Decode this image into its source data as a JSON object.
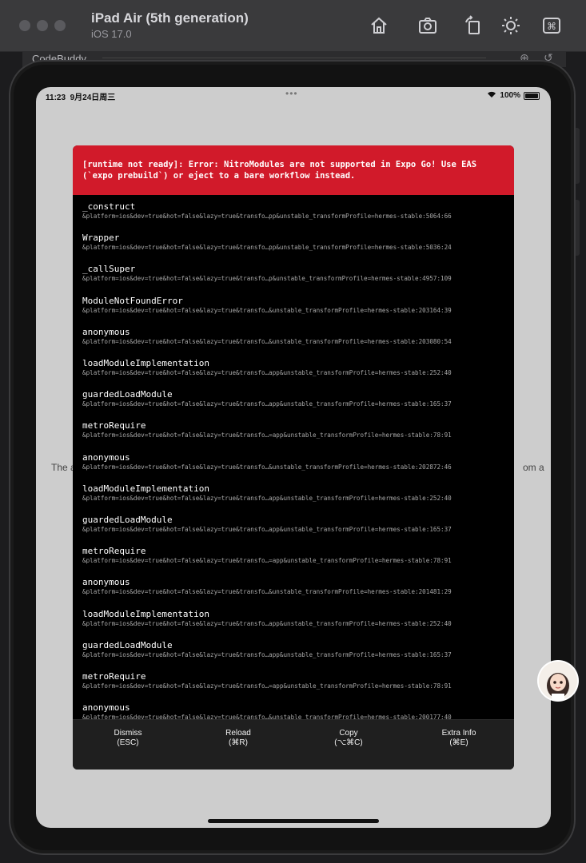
{
  "simulator": {
    "device_name": "iPad Air (5th generation)",
    "os_version": "iOS 17.0",
    "toolbar_icons": [
      "home-icon",
      "screenshot-icon",
      "rotate-icon",
      "appearance-icon",
      "command-icon"
    ]
  },
  "background_window": {
    "title": "CodeBuddy",
    "icons": [
      "add-icon",
      "history-icon"
    ]
  },
  "status_bar": {
    "time": "11:23",
    "date": "9月24日周三",
    "battery": "100%"
  },
  "background_app_text": {
    "left": "The a",
    "right": "om a"
  },
  "error": {
    "message": "[runtime not ready]: Error: NitroModules are not supported in Expo Go! Use EAS (`expo prebuild`) or eject to a bare workflow instead.",
    "stack": [
      {
        "name": "_construct",
        "location": "&platform=ios&dev=true&hot=false&lazy=true&transfo…pp&unstable_transformProfile=hermes-stable:5064:66"
      },
      {
        "name": "Wrapper",
        "location": "&platform=ios&dev=true&hot=false&lazy=true&transfo…pp&unstable_transformProfile=hermes-stable:5036:24"
      },
      {
        "name": "_callSuper",
        "location": "&platform=ios&dev=true&hot=false&lazy=true&transfo…p&unstable_transformProfile=hermes-stable:4957:109"
      },
      {
        "name": "ModuleNotFoundError",
        "location": "&platform=ios&dev=true&hot=false&lazy=true&transfo…&unstable_transformProfile=hermes-stable:203164:39"
      },
      {
        "name": "anonymous",
        "location": "&platform=ios&dev=true&hot=false&lazy=true&transfo…&unstable_transformProfile=hermes-stable:203080:54"
      },
      {
        "name": "loadModuleImplementation",
        "location": "&platform=ios&dev=true&hot=false&lazy=true&transfo…app&unstable_transformProfile=hermes-stable:252:40"
      },
      {
        "name": "guardedLoadModule",
        "location": "&platform=ios&dev=true&hot=false&lazy=true&transfo…app&unstable_transformProfile=hermes-stable:165:37"
      },
      {
        "name": "metroRequire",
        "location": "&platform=ios&dev=true&hot=false&lazy=true&transfo…=app&unstable_transformProfile=hermes-stable:78:91"
      },
      {
        "name": "anonymous",
        "location": "&platform=ios&dev=true&hot=false&lazy=true&transfo…&unstable_transformProfile=hermes-stable:202872:46"
      },
      {
        "name": "loadModuleImplementation",
        "location": "&platform=ios&dev=true&hot=false&lazy=true&transfo…app&unstable_transformProfile=hermes-stable:252:40"
      },
      {
        "name": "guardedLoadModule",
        "location": "&platform=ios&dev=true&hot=false&lazy=true&transfo…app&unstable_transformProfile=hermes-stable:165:37"
      },
      {
        "name": "metroRequire",
        "location": "&platform=ios&dev=true&hot=false&lazy=true&transfo…=app&unstable_transformProfile=hermes-stable:78:91"
      },
      {
        "name": "anonymous",
        "location": "&platform=ios&dev=true&hot=false&lazy=true&transfo…&unstable_transformProfile=hermes-stable:201481:29"
      },
      {
        "name": "loadModuleImplementation",
        "location": "&platform=ios&dev=true&hot=false&lazy=true&transfo…app&unstable_transformProfile=hermes-stable:252:40"
      },
      {
        "name": "guardedLoadModule",
        "location": "&platform=ios&dev=true&hot=false&lazy=true&transfo…app&unstable_transformProfile=hermes-stable:165:37"
      },
      {
        "name": "metroRequire",
        "location": "&platform=ios&dev=true&hot=false&lazy=true&transfo…=app&unstable_transformProfile=hermes-stable:78:91"
      },
      {
        "name": "anonymous",
        "location": "&platform=ios&dev=true&hot=false&lazy=true&transfo…&unstable_transformProfile=hermes-stable:200177:40"
      }
    ]
  },
  "footer": {
    "buttons": [
      {
        "label": "Dismiss",
        "shortcut": "(ESC)"
      },
      {
        "label": "Reload",
        "shortcut": "(⌘R)"
      },
      {
        "label": "Copy",
        "shortcut": "(⌥⌘C)"
      },
      {
        "label": "Extra Info",
        "shortcut": "(⌘E)"
      }
    ]
  },
  "colors": {
    "error_header": "#d11a2a",
    "overlay_bg": "#000000",
    "footer_bg": "#1f1f1f",
    "screen_bg": "#cdcdcd"
  }
}
